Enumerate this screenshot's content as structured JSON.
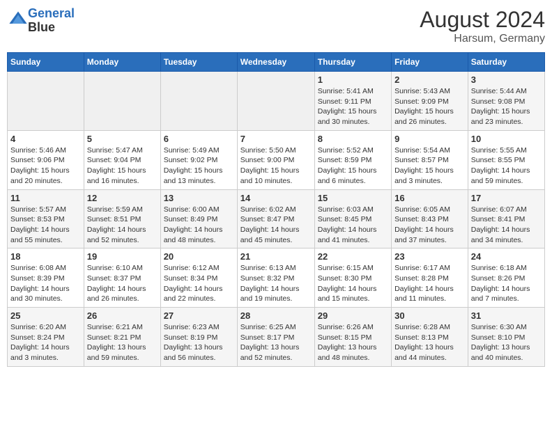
{
  "header": {
    "logo_line1": "General",
    "logo_line2": "Blue",
    "month_year": "August 2024",
    "location": "Harsum, Germany"
  },
  "days_of_week": [
    "Sunday",
    "Monday",
    "Tuesday",
    "Wednesday",
    "Thursday",
    "Friday",
    "Saturday"
  ],
  "weeks": [
    [
      {
        "day": "",
        "info": ""
      },
      {
        "day": "",
        "info": ""
      },
      {
        "day": "",
        "info": ""
      },
      {
        "day": "",
        "info": ""
      },
      {
        "day": "1",
        "info": "Sunrise: 5:41 AM\nSunset: 9:11 PM\nDaylight: 15 hours\nand 30 minutes."
      },
      {
        "day": "2",
        "info": "Sunrise: 5:43 AM\nSunset: 9:09 PM\nDaylight: 15 hours\nand 26 minutes."
      },
      {
        "day": "3",
        "info": "Sunrise: 5:44 AM\nSunset: 9:08 PM\nDaylight: 15 hours\nand 23 minutes."
      }
    ],
    [
      {
        "day": "4",
        "info": "Sunrise: 5:46 AM\nSunset: 9:06 PM\nDaylight: 15 hours\nand 20 minutes."
      },
      {
        "day": "5",
        "info": "Sunrise: 5:47 AM\nSunset: 9:04 PM\nDaylight: 15 hours\nand 16 minutes."
      },
      {
        "day": "6",
        "info": "Sunrise: 5:49 AM\nSunset: 9:02 PM\nDaylight: 15 hours\nand 13 minutes."
      },
      {
        "day": "7",
        "info": "Sunrise: 5:50 AM\nSunset: 9:00 PM\nDaylight: 15 hours\nand 10 minutes."
      },
      {
        "day": "8",
        "info": "Sunrise: 5:52 AM\nSunset: 8:59 PM\nDaylight: 15 hours\nand 6 minutes."
      },
      {
        "day": "9",
        "info": "Sunrise: 5:54 AM\nSunset: 8:57 PM\nDaylight: 15 hours\nand 3 minutes."
      },
      {
        "day": "10",
        "info": "Sunrise: 5:55 AM\nSunset: 8:55 PM\nDaylight: 14 hours\nand 59 minutes."
      }
    ],
    [
      {
        "day": "11",
        "info": "Sunrise: 5:57 AM\nSunset: 8:53 PM\nDaylight: 14 hours\nand 55 minutes."
      },
      {
        "day": "12",
        "info": "Sunrise: 5:59 AM\nSunset: 8:51 PM\nDaylight: 14 hours\nand 52 minutes."
      },
      {
        "day": "13",
        "info": "Sunrise: 6:00 AM\nSunset: 8:49 PM\nDaylight: 14 hours\nand 48 minutes."
      },
      {
        "day": "14",
        "info": "Sunrise: 6:02 AM\nSunset: 8:47 PM\nDaylight: 14 hours\nand 45 minutes."
      },
      {
        "day": "15",
        "info": "Sunrise: 6:03 AM\nSunset: 8:45 PM\nDaylight: 14 hours\nand 41 minutes."
      },
      {
        "day": "16",
        "info": "Sunrise: 6:05 AM\nSunset: 8:43 PM\nDaylight: 14 hours\nand 37 minutes."
      },
      {
        "day": "17",
        "info": "Sunrise: 6:07 AM\nSunset: 8:41 PM\nDaylight: 14 hours\nand 34 minutes."
      }
    ],
    [
      {
        "day": "18",
        "info": "Sunrise: 6:08 AM\nSunset: 8:39 PM\nDaylight: 14 hours\nand 30 minutes."
      },
      {
        "day": "19",
        "info": "Sunrise: 6:10 AM\nSunset: 8:37 PM\nDaylight: 14 hours\nand 26 minutes."
      },
      {
        "day": "20",
        "info": "Sunrise: 6:12 AM\nSunset: 8:34 PM\nDaylight: 14 hours\nand 22 minutes."
      },
      {
        "day": "21",
        "info": "Sunrise: 6:13 AM\nSunset: 8:32 PM\nDaylight: 14 hours\nand 19 minutes."
      },
      {
        "day": "22",
        "info": "Sunrise: 6:15 AM\nSunset: 8:30 PM\nDaylight: 14 hours\nand 15 minutes."
      },
      {
        "day": "23",
        "info": "Sunrise: 6:17 AM\nSunset: 8:28 PM\nDaylight: 14 hours\nand 11 minutes."
      },
      {
        "day": "24",
        "info": "Sunrise: 6:18 AM\nSunset: 8:26 PM\nDaylight: 14 hours\nand 7 minutes."
      }
    ],
    [
      {
        "day": "25",
        "info": "Sunrise: 6:20 AM\nSunset: 8:24 PM\nDaylight: 14 hours\nand 3 minutes."
      },
      {
        "day": "26",
        "info": "Sunrise: 6:21 AM\nSunset: 8:21 PM\nDaylight: 13 hours\nand 59 minutes."
      },
      {
        "day": "27",
        "info": "Sunrise: 6:23 AM\nSunset: 8:19 PM\nDaylight: 13 hours\nand 56 minutes."
      },
      {
        "day": "28",
        "info": "Sunrise: 6:25 AM\nSunset: 8:17 PM\nDaylight: 13 hours\nand 52 minutes."
      },
      {
        "day": "29",
        "info": "Sunrise: 6:26 AM\nSunset: 8:15 PM\nDaylight: 13 hours\nand 48 minutes."
      },
      {
        "day": "30",
        "info": "Sunrise: 6:28 AM\nSunset: 8:13 PM\nDaylight: 13 hours\nand 44 minutes."
      },
      {
        "day": "31",
        "info": "Sunrise: 6:30 AM\nSunset: 8:10 PM\nDaylight: 13 hours\nand 40 minutes."
      }
    ]
  ]
}
